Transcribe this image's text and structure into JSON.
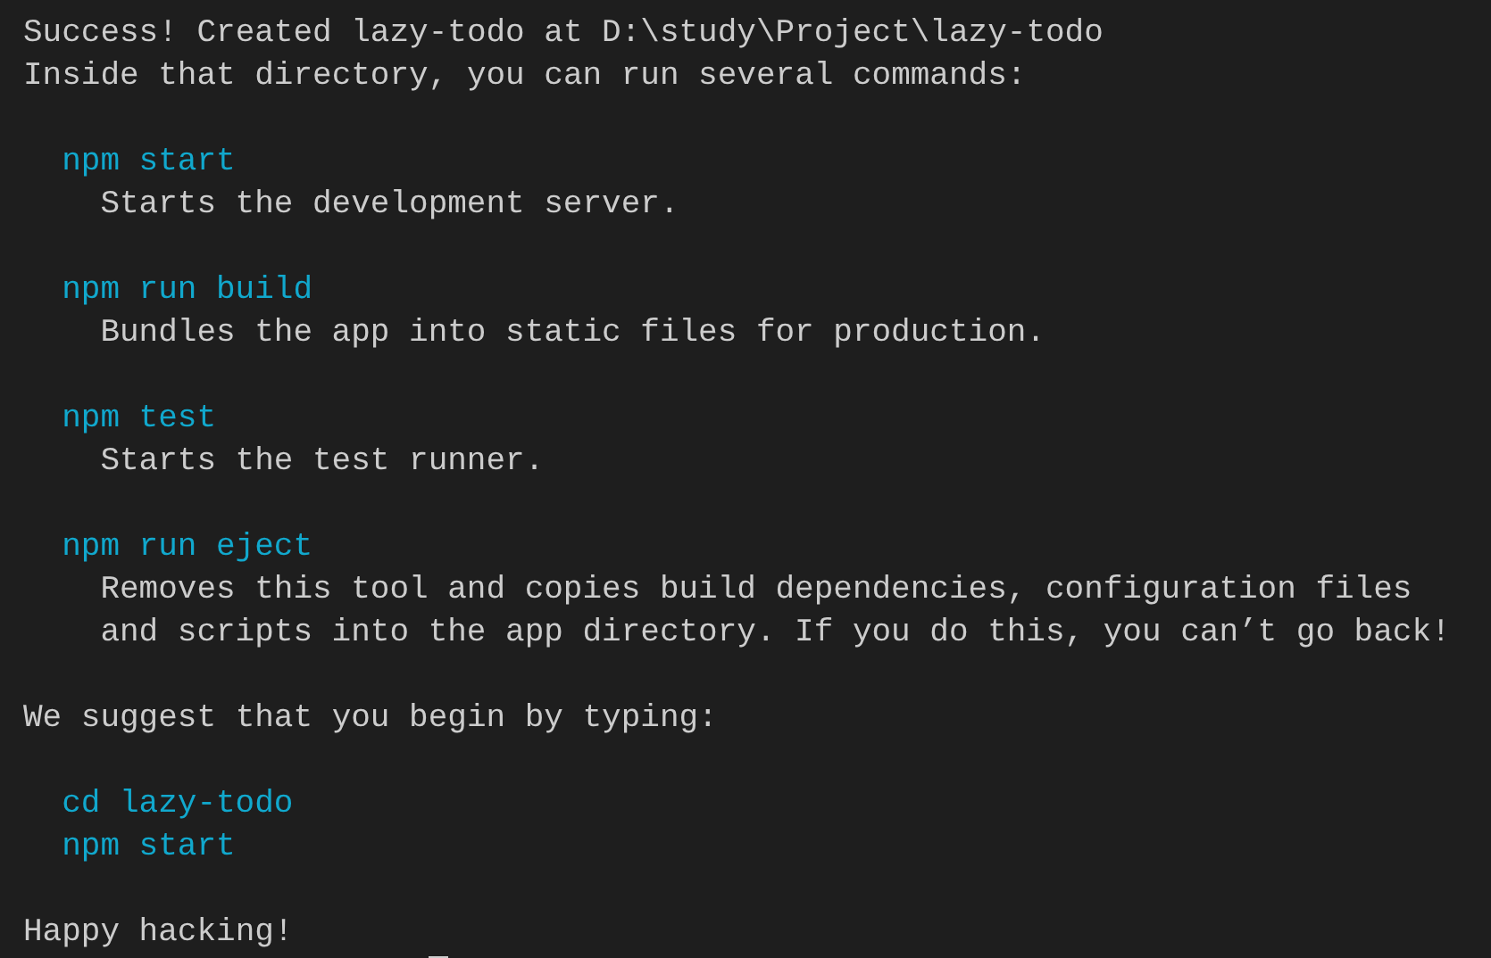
{
  "header": [
    "Success! Created lazy-todo at D:\\study\\Project\\lazy-todo",
    "Inside that directory, you can run several commands:"
  ],
  "commands": [
    {
      "command": "npm start",
      "description": [
        "Starts the development server."
      ]
    },
    {
      "command": "npm run build",
      "description": [
        "Bundles the app into static files for production."
      ]
    },
    {
      "command": "npm test",
      "description": [
        "Starts the test runner."
      ]
    },
    {
      "command": "npm run eject",
      "description": [
        "Removes this tool and copies build dependencies, configuration files",
        "and scripts into the app directory. If you do this, you can’t go back!"
      ]
    }
  ],
  "suggestion": "We suggest that you begin by typing:",
  "steps": [
    "cd lazy-todo",
    "npm start"
  ],
  "footer": "Happy hacking!"
}
